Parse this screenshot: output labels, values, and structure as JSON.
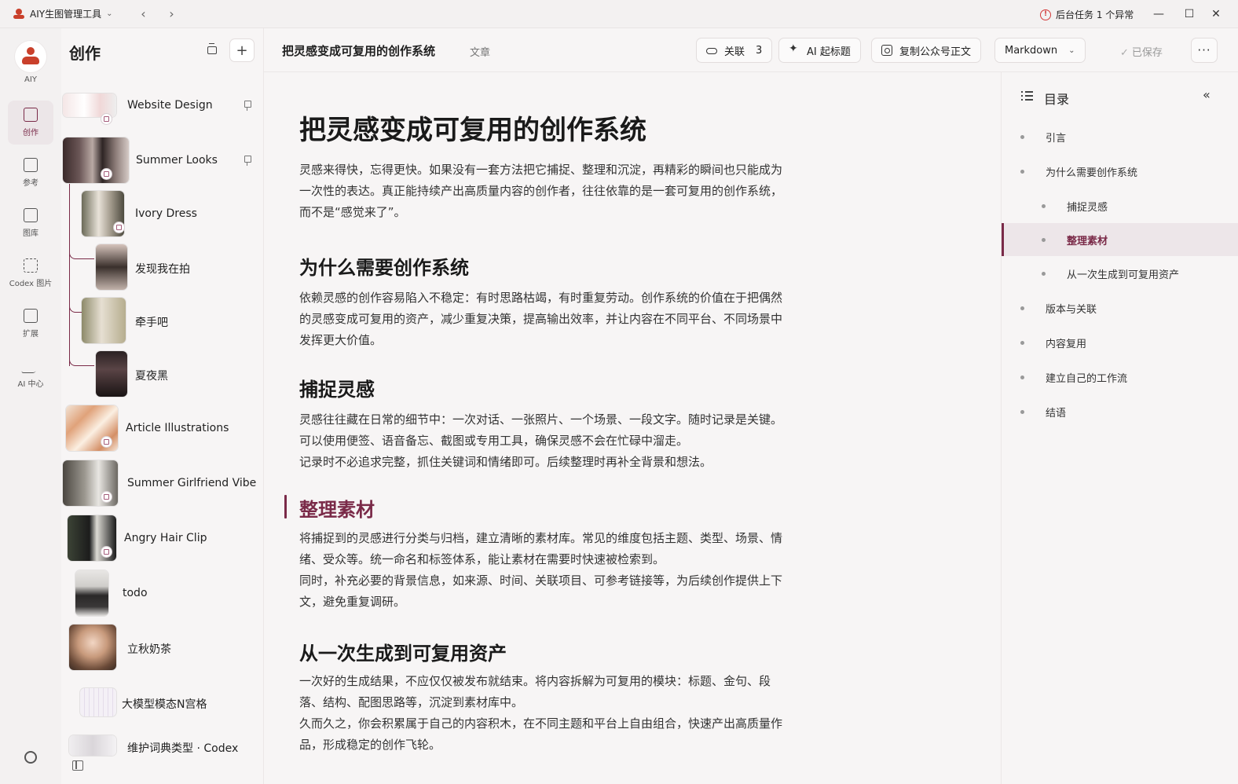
{
  "titlebar": {
    "app_name": "AIY生图管理工具",
    "background_task": "后台任务 1 个异常",
    "controls": {
      "minimize": "—",
      "maximize": "☐",
      "close": "✕"
    }
  },
  "rail": {
    "avatar_label": "AIY",
    "items": [
      {
        "label": "创作",
        "icon": "edit-icon",
        "active": true
      },
      {
        "label": "参考",
        "icon": "document-icon",
        "active": false
      },
      {
        "label": "图库",
        "icon": "gallery-icon",
        "active": false
      },
      {
        "label": "Codex 图片",
        "icon": "scan-icon",
        "active": false
      },
      {
        "label": "扩展",
        "icon": "extension-icon",
        "active": false
      },
      {
        "label": "AI 中心",
        "icon": "activity-icon",
        "active": false
      }
    ]
  },
  "sidebar": {
    "title": "创作",
    "add_label": "+",
    "items": [
      {
        "label": "Website Design",
        "pinned": true
      },
      {
        "label": "Summer Looks",
        "pinned": true
      },
      {
        "label": "Ivory Dress",
        "pinned": false
      },
      {
        "label": "发现我在拍",
        "pinned": false
      },
      {
        "label": "牵手吧",
        "pinned": false
      },
      {
        "label": "夏夜黑",
        "pinned": false
      },
      {
        "label": "Article Illustrations",
        "pinned": false
      },
      {
        "label": "Summer Girlfriend Vibe",
        "pinned": false
      },
      {
        "label": "Angry Hair Clip",
        "pinned": false
      },
      {
        "label": "todo",
        "pinned": false
      },
      {
        "label": "立秋奶茶",
        "pinned": false
      },
      {
        "label": "大模型模态N宫格",
        "pinned": false
      },
      {
        "label": "维护词典类型 · Codex",
        "pinned": false
      }
    ]
  },
  "header": {
    "doc_title": "把灵感变成可复用的创作系统",
    "doc_type": "文章",
    "link_label": "关联",
    "link_count": "3",
    "ai_title_label": "AI 起标题",
    "copy_label": "复制公众号正文",
    "format_label": "Markdown",
    "saved_label": "已保存",
    "more_label": "···"
  },
  "article": {
    "title": "把灵感变成可复用的创作系统",
    "intro": [
      "灵感来得快，忘得更快。如果没有一套方法把它捕捉、整理和沉淀，再精彩的瞬间也只能成为",
      "一次性的表达。真正能持续产出高质量内容的创作者，往往依靠的是一套可复用的创作系统，",
      "而不是“感觉来了”。"
    ],
    "sections": [
      {
        "heading": "为什么需要创作系统",
        "lines": [
          "依赖灵感的创作容易陷入不稳定：有时思路枯竭，有时重复劳动。创作系统的价值在于把偶然",
          "的灵感变成可复用的资产，减少重复决策，提高输出效率，并让内容在不同平台、不同场景中",
          "发挥更大价值。"
        ]
      },
      {
        "heading": "捕捉灵感",
        "lines": [
          "灵感往往藏在日常的细节中：一次对话、一张照片、一个场景、一段文字。随时记录是关键。",
          "可以使用便签、语音备忘、截图或专用工具，确保灵感不会在忙碌中溜走。",
          "记录时不必追求完整，抓住关键词和情绪即可。后续整理时再补全背景和想法。"
        ]
      },
      {
        "heading": "整理素材",
        "lines": [
          "将捕捉到的灵感进行分类与归档，建立清晰的素材库。常见的维度包括主题、类型、场景、情",
          "绪、受众等。统一命名和标签体系，能让素材在需要时快速被检索到。",
          "同时，补充必要的背景信息，如来源、时间、关联项目、可参考链接等，为后续创作提供上下",
          "文，避免重复调研。"
        ]
      },
      {
        "heading": "从一次生成到可复用资产",
        "lines": [
          "一次好的生成结果，不应仅仅被发布就结束。将内容拆解为可复用的模块：标题、金句、段",
          "落、结构、配图思路等，沉淀到素材库中。",
          "久而久之，你会积累属于自己的内容积木，在不同主题和平台上自由组合，快速产出高质量作",
          "品，形成稳定的创作飞轮。"
        ]
      }
    ]
  },
  "toc": {
    "title": "目录",
    "collapse_label": "«",
    "items": [
      {
        "label": "引言",
        "level": 1,
        "active": false
      },
      {
        "label": "为什么需要创作系统",
        "level": 1,
        "active": false
      },
      {
        "label": "捕捉灵感",
        "level": 2,
        "active": false
      },
      {
        "label": "整理素材",
        "level": 2,
        "active": true
      },
      {
        "label": "从一次生成到可复用资产",
        "level": 2,
        "active": false
      },
      {
        "label": "版本与关联",
        "level": 1,
        "active": false
      },
      {
        "label": "内容复用",
        "level": 1,
        "active": false
      },
      {
        "label": "建立自己的工作流",
        "level": 1,
        "active": false
      },
      {
        "label": "结语",
        "level": 1,
        "active": false
      }
    ]
  },
  "colors": {
    "accent": "#7a2a48",
    "brand": "#c9402b",
    "warning": "#d23a3a"
  }
}
